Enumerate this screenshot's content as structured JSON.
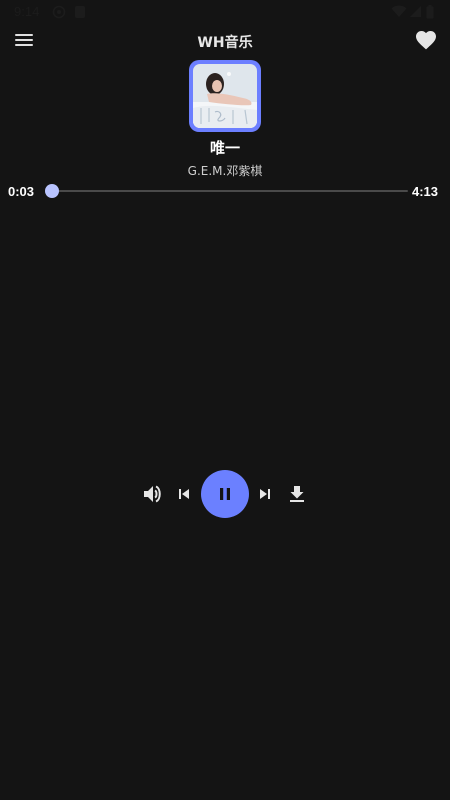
{
  "status_bar": {
    "time": "9:14",
    "icons": [
      "settings-icon",
      "blocked-icon",
      "wifi-icon",
      "signal-icon",
      "battery-icon"
    ]
  },
  "app_bar": {
    "title": "WH音乐",
    "menu_icon": "menu-icon",
    "favorite_icon": "heart-icon"
  },
  "track": {
    "title": "唯一",
    "artist": "G.E.M.邓紫棋",
    "current_time": "0:03",
    "total_time": "4:13",
    "progress_fraction": 0.012
  },
  "controls": {
    "volume_icon": "volume-icon",
    "previous_icon": "skip-previous-icon",
    "play_state_icon": "pause-icon",
    "next_icon": "skip-next-icon",
    "download_icon": "download-icon"
  },
  "colors": {
    "background": "#141414",
    "accent": "#6b80ff",
    "progress": "#b9c4ff"
  }
}
